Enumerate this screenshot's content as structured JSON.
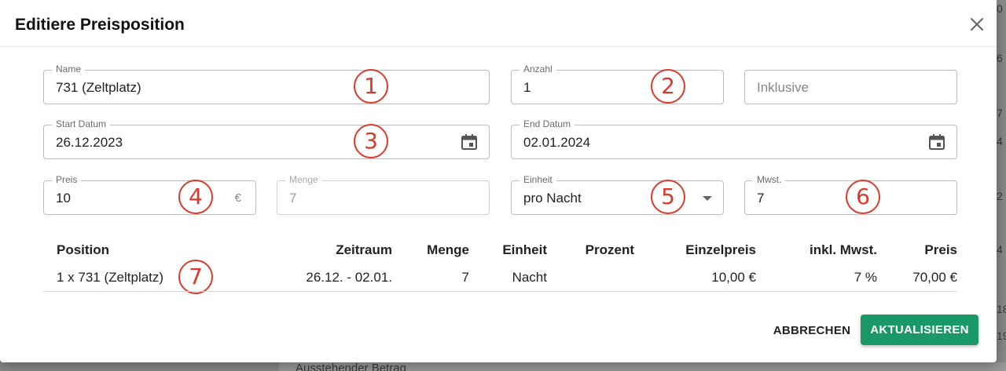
{
  "background": {
    "footer_text": "Ausstehender Betrag",
    "edge_numbers": [
      "0",
      "6",
      "7",
      "4",
      "2",
      "4",
      "18",
      "19"
    ]
  },
  "dialog": {
    "title": "Editiere Preisposition",
    "close_icon": "close-icon",
    "fields": {
      "name": {
        "label": "Name",
        "value": "731 (Zeltplatz)"
      },
      "anzahl": {
        "label": "Anzahl",
        "value": "1"
      },
      "inklusive": {
        "placeholder": "Inklusive"
      },
      "start_datum": {
        "label": "Start Datum",
        "value": "26.12.2023",
        "icon": "calendar-icon"
      },
      "end_datum": {
        "label": "End Datum",
        "value": "02.01.2024",
        "icon": "calendar-icon"
      },
      "preis": {
        "label": "Preis",
        "value": "10",
        "suffix": "€"
      },
      "menge": {
        "label": "Menge",
        "value": "7"
      },
      "einheit": {
        "label": "Einheit",
        "value": "pro Nacht",
        "icon": "caret-down-icon"
      },
      "mwst": {
        "label": "Mwst.",
        "value": "7"
      }
    },
    "markers": [
      "1",
      "2",
      "3",
      "4",
      "5",
      "6",
      "7"
    ],
    "table": {
      "headers": {
        "position": "Position",
        "zeitraum": "Zeitraum",
        "menge": "Menge",
        "einheit": "Einheit",
        "prozent": "Prozent",
        "einzelpreis": "Einzelpreis",
        "mwst": "inkl. Mwst.",
        "preis": "Preis"
      },
      "row": {
        "position": "1 x 731 (Zeltplatz)",
        "zeitraum": "26.12. - 02.01.",
        "menge": "7",
        "einheit": "Nacht",
        "prozent": "",
        "einzelpreis": "10,00 €",
        "mwst": "7 %",
        "preis": "70,00 €"
      }
    },
    "actions": {
      "cancel_label": "ABBRECHEN",
      "update_label": "AKTUALISIEREN"
    },
    "colors": {
      "accent": "#1a9867",
      "marker": "#d93a2b"
    }
  }
}
